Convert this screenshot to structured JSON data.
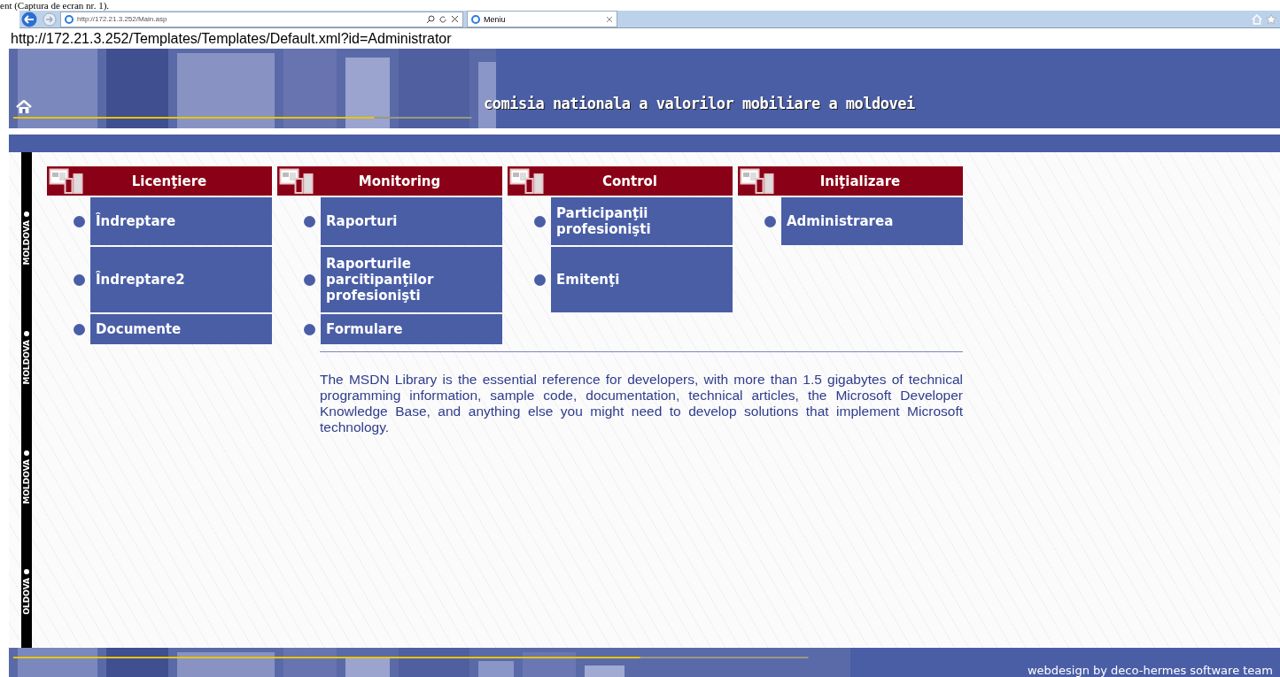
{
  "caption": "ent (Captura de ecran nr. 1).",
  "browser": {
    "address": "http://172.21.3.252/Main.asp",
    "tab": {
      "label": "Meniu",
      "selected": true
    }
  },
  "url_line": "http://172.21.3.252/Templates/Templates/Default.xml?id=Administrator",
  "header": {
    "title": "comisia nationala a valorilor mobiliare a moldovei"
  },
  "side_strip": [
    "MOLDOVA",
    "MOLDOVA",
    "MOLDOVA",
    "OLDOVA"
  ],
  "menu": [
    {
      "title": "Licenţiere",
      "items": [
        {
          "label": "Îndreptare"
        },
        {
          "label": "Îndreptare2"
        },
        {
          "label": "Documente"
        }
      ]
    },
    {
      "title": "Monitoring",
      "items": [
        {
          "label": "Raporturi"
        },
        {
          "label": "Raporturile parcitipanţilor profesionişti"
        },
        {
          "label": "Formulare"
        }
      ]
    },
    {
      "title": "Control",
      "items": [
        {
          "label": "Participanţii profesionişti"
        },
        {
          "label": "Emitenţi"
        }
      ]
    },
    {
      "title": "Iniţializare",
      "items": [
        {
          "label": "Administrarea"
        }
      ]
    }
  ],
  "description": "The MSDN Library is the essential reference for developers, with more than 1.5 gigabytes of technical programming information, sample code, documentation, technical articles, the Microsoft Developer Knowledge Base, and anything else you might need to develop solutions that implement Microsoft technology.",
  "footer": "webdesign by deco-hermes software team"
}
